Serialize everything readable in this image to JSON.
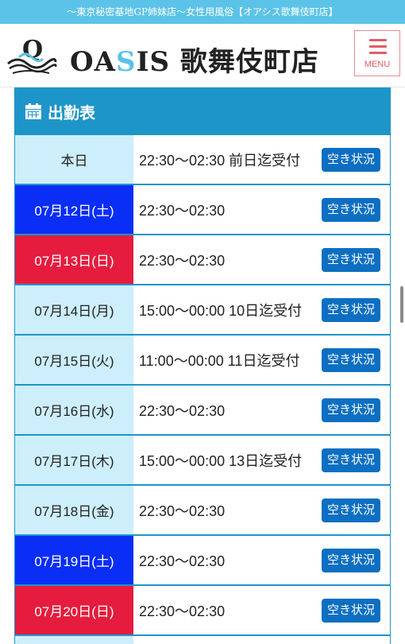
{
  "topbar": {
    "text": "〜東京秘密基地GP姉妹店〜女性用風俗【オアシス歌舞伎町店】"
  },
  "header": {
    "logo_mark": "Q",
    "logo_pre": "OA",
    "logo_s": "S",
    "logo_post": "IS 歌舞伎町店",
    "menu_label": "MENU"
  },
  "schedule": {
    "title": "出勤表",
    "button_label": "空き状況",
    "rows": [
      {
        "date": "本日",
        "time": "22:30〜02:30 前日迄受付",
        "type": "today"
      },
      {
        "date": "07月12日(土)",
        "time": "22:30〜02:30",
        "type": "sat"
      },
      {
        "date": "07月13日(日)",
        "time": "22:30〜02:30",
        "type": "sun"
      },
      {
        "date": "07月14日(月)",
        "time": "15:00〜00:00 10日迄受付",
        "type": "weekday"
      },
      {
        "date": "07月15日(火)",
        "time": "11:00〜00:00 11日迄受付",
        "type": "weekday"
      },
      {
        "date": "07月16日(水)",
        "time": "22:30〜02:30",
        "type": "weekday"
      },
      {
        "date": "07月17日(木)",
        "time": "15:00〜00:00 13日迄受付",
        "type": "weekday"
      },
      {
        "date": "07月18日(金)",
        "time": "22:30〜02:30",
        "type": "weekday"
      },
      {
        "date": "07月19日(土)",
        "time": "22:30〜02:30",
        "type": "sat"
      },
      {
        "date": "07月20日(日)",
        "time": "22:30〜02:30",
        "type": "sun"
      }
    ]
  },
  "colors": {
    "accent": "#1e95c8",
    "topbar": "#5cc3e8",
    "saturday": "#0a2ef5",
    "sunday": "#e51c3e",
    "weekday": "#cdeefb",
    "button": "#0d6fc2",
    "menu": "#e45a63"
  }
}
